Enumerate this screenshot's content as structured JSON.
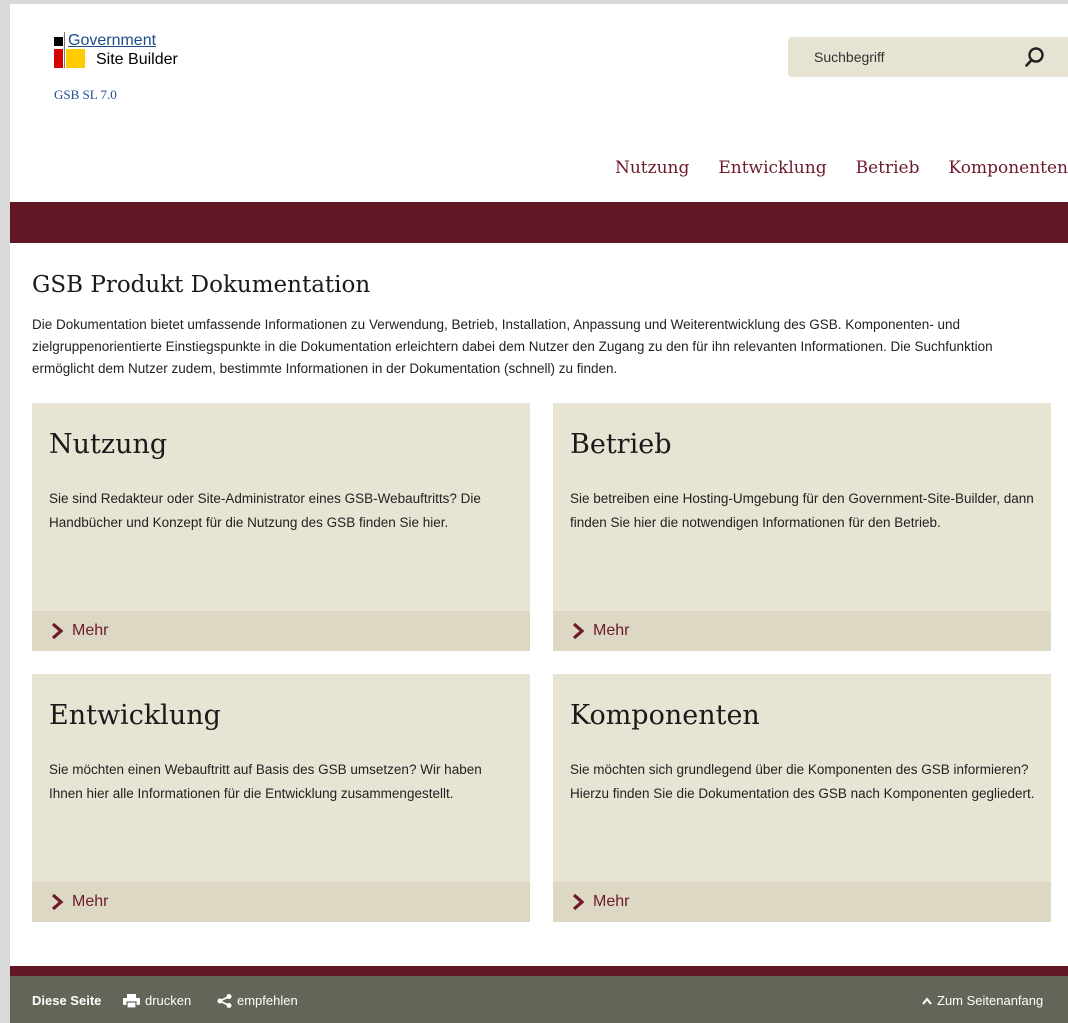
{
  "logo": {
    "line1": "Government",
    "line2": "Site Builder",
    "version": "GSB SL 7.0",
    "colors": [
      "#000000",
      "#d40000",
      "#ffcc00"
    ]
  },
  "search": {
    "placeholder": "Suchbegriff",
    "icon": "search-icon"
  },
  "nav": {
    "items": [
      "Nutzung",
      "Entwicklung",
      "Betrieb",
      "Komponenten"
    ]
  },
  "main": {
    "title": "GSB Produkt Dokumentation",
    "intro": "Die Dokumentation bietet umfassende Informationen zu Verwendung, Betrieb, Installation, Anpassung und Weiterentwicklung des GSB. Komponenten- und zielgruppenorientierte Einstiegspunkte in die Dokumentation erleichtern dabei dem Nutzer den Zugang zu den für ihn relevanten Informationen. Die Suchfunktion ermöglicht dem Nutzer zudem, bestimmte Informationen in der Dokumentation (schnell) zu finden."
  },
  "cards": [
    {
      "title": "Nutzung",
      "text": "Sie sind Redakteur oder Site-Administrator eines GSB-Webauftritts? Die Handbücher und Konzept für die Nutzung des GSB finden Sie hier.",
      "more": "Mehr"
    },
    {
      "title": "Betrieb",
      "text": "Sie betreiben eine Hosting-Umgebung für den Government-Site-Builder, dann finden Sie hier die notwendigen Informationen für den Betrieb.",
      "more": "Mehr"
    },
    {
      "title": "Entwicklung",
      "text": "Sie möchten einen Webauftritt auf Basis des GSB umsetzen? Wir haben Ihnen hier alle Informationen für die Entwicklung zusammengestellt.",
      "more": "Mehr"
    },
    {
      "title": "Komponenten",
      "text": "Sie möchten sich grundlegend über die Komponenten des GSB informieren? Hierzu finden Sie die Dokumentation des GSB nach Komponenten gegliedert.",
      "more": "Mehr"
    }
  ],
  "footer": {
    "label": "Diese Seite",
    "print": "drucken",
    "share": "empfehlen",
    "top": "Zum Seitenanfang"
  },
  "colors": {
    "accent": "#621726",
    "link": "#6d1a2a",
    "card_bg": "#e7e4d4",
    "footer_bg": "#646459"
  }
}
